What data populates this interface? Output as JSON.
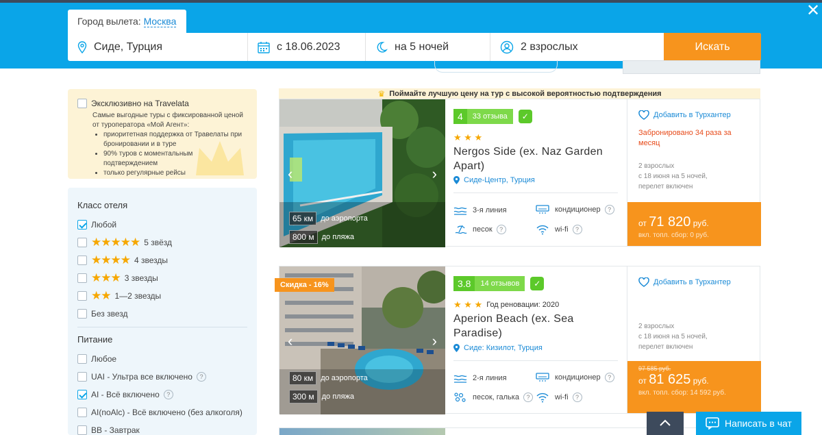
{
  "header": {
    "depart_label": "Город вылета:",
    "depart_city": "Москва",
    "destination": "Сиде, Турция",
    "date": "с 18.06.2023",
    "nights": "на 5 ночей",
    "people": "2 взрослых",
    "search_label": "Искать",
    "close": "✕"
  },
  "exclusive": {
    "title": "Эксклюзивно на Travelata",
    "desc": "Самые выгодные туры с фиксированной ценой от туроператора «Мой Агент»:",
    "bullets": [
      "приоритетная поддержка от Травелаты при бронировании и в туре",
      "90% туров с моментальным подтверждением",
      "только регулярные рейсы"
    ]
  },
  "filters": {
    "class_title": "Класс отеля",
    "class_options": [
      {
        "label": "Любой",
        "checked": true,
        "stars": 0
      },
      {
        "label": "5 звёзд",
        "checked": false,
        "stars": 5
      },
      {
        "label": "4 звезды",
        "checked": false,
        "stars": 4
      },
      {
        "label": "3 звезды",
        "checked": false,
        "stars": 3
      },
      {
        "label": "1—2 звезды",
        "checked": false,
        "stars": 2
      },
      {
        "label": "Без звезд",
        "checked": false,
        "stars": 0
      }
    ],
    "food_title": "Питание",
    "food_options": [
      {
        "label": "Любое",
        "checked": false
      },
      {
        "label": "UAI - Ультра все включено",
        "checked": false
      },
      {
        "label": "AI - Всё включено",
        "checked": true
      },
      {
        "label": "AI(noAlc) - Всё включено (без алкоголя)",
        "checked": false
      },
      {
        "label": "BB - Завтрак",
        "checked": false
      }
    ]
  },
  "promo": "Поймайте лучшую цену на тур с высокой вероятностью подтверждения",
  "hotels": [
    {
      "rating": "4",
      "reviews": "33 отзыва",
      "stars": "★ ★ ★",
      "renovation": "",
      "name": "Nergos Side (ex. Naz Garden Apart)",
      "location": "Сиде-Центр, Турция",
      "airport_km": "65 км",
      "airport_label": "до аэропорта",
      "beach_m": "800 м",
      "beach_label": "до пляжа",
      "line": "3-я линия",
      "beach_type": "песок",
      "ac": "кондиционер",
      "wifi": "wi-fi",
      "fav": "Добавить в Турхантер",
      "booked": "Забронировано 34 раза за месяц",
      "cond1": "2 взрослых",
      "cond2": "с 18 июня на 5 ночей,",
      "cond3": "перелет включен",
      "old_price": "",
      "price_prefix": "от",
      "price": "71 820",
      "currency": "руб.",
      "fee": "вкл. топл. сбор: 0 руб.",
      "discount": ""
    },
    {
      "rating": "3.8",
      "reviews": "14 отзывов",
      "stars": "★ ★ ★",
      "renovation": "Год реновации: 2020",
      "name": "Aperion Beach (ex. Sea Paradise)",
      "location": "Сиде: Кизилот, Турция",
      "airport_km": "80 км",
      "airport_label": "до аэропорта",
      "beach_m": "300 м",
      "beach_label": "до пляжа",
      "line": "2-я линия",
      "beach_type": "песок, галька",
      "ac": "кондиционер",
      "wifi": "wi-fi",
      "fav": "Добавить в Турхантер",
      "booked": "",
      "cond1": "2 взрослых",
      "cond2": "с 18 июня на 5 ночей,",
      "cond3": "перелет включен",
      "old_price": "97 585 руб.",
      "price_prefix": "от",
      "price": "81 625",
      "currency": "руб.",
      "fee": "вкл. топл. сбор: 14 592 руб.",
      "discount": "Скидка - 16%"
    }
  ],
  "widgets": {
    "chat": "Написать в чат",
    "up": "^"
  },
  "colors": {
    "header_blue": "#0aa5e8",
    "accent_orange": "#f7941d",
    "rating_green": "#5cc92a",
    "link_blue": "#1a8ad6"
  }
}
